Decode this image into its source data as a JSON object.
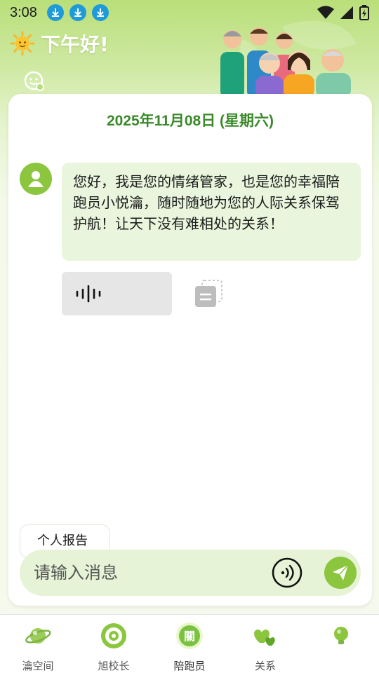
{
  "status_bar": {
    "time": "3:08",
    "notifications": [
      "download-icon",
      "download-icon",
      "download-icon"
    ],
    "icons": [
      "wifi-icon",
      "signal-icon",
      "battery-charging-icon"
    ]
  },
  "header": {
    "greeting": "下午好!",
    "greeting_icon": "sun-icon",
    "emotion_icon": "emotion-face-icon"
  },
  "chat": {
    "date": "2025年11月08日 (星期六)",
    "messages": [
      {
        "sender_icon": "user-avatar-icon",
        "text": "您好，我是您的情绪管家，也是您的幸福陪跑员小悦瀹，随时随地为您的人际关系保驾护航！让天下没有难相处的关系！"
      }
    ],
    "voice_icon": "waveform-icon",
    "copy_icon": "copy-icon"
  },
  "report_chip": {
    "label": "个人报告"
  },
  "composer": {
    "placeholder": "请输入消息",
    "voice_toggle_icon": "voice-mode-icon",
    "send_icon": "send-icon"
  },
  "tabs": [
    {
      "label": "瀹空间",
      "icon": "planet-icon",
      "active": false
    },
    {
      "label": "旭校长",
      "icon": "target-icon",
      "active": false
    },
    {
      "label": "陪跑员",
      "icon": "guan-badge-icon",
      "active": true
    },
    {
      "label": "关系",
      "icon": "hearts-icon",
      "active": false
    },
    {
      "label": "",
      "icon": "lightbulb-icon",
      "active": false
    }
  ],
  "colors": {
    "accent": "#8cc63f",
    "date_text": "#3a8a2a",
    "bubble_bg": "#eaf5dd",
    "input_bg": "#e6f3d6",
    "download_badge": "#1e9bd8"
  }
}
